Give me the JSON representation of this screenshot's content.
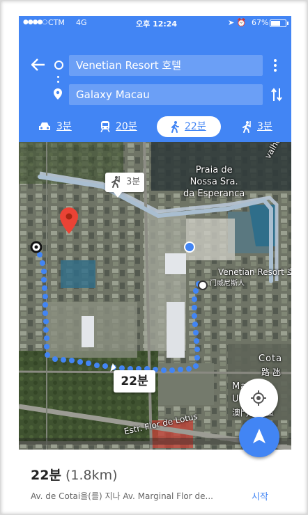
{
  "status": {
    "carrier": "CTM",
    "network": "4G",
    "time": "오후 12:24",
    "battery": "67%",
    "battery_level": 0.67
  },
  "route": {
    "origin": "Venetian Resort 호텔",
    "destination": "Galaxy Macau"
  },
  "modes": [
    {
      "name": "drive",
      "icon": "car-icon",
      "label": "3분",
      "selected": false
    },
    {
      "name": "transit",
      "icon": "train-icon",
      "label": "20분",
      "selected": false
    },
    {
      "name": "walk",
      "icon": "walk-icon",
      "label": "22분",
      "selected": true
    },
    {
      "name": "ride",
      "icon": "ride-icon",
      "label": "3분",
      "selected": false
    }
  ],
  "map": {
    "labels": {
      "valho": "valho",
      "praia_line1": "Praia de",
      "praia_line2": "Nossa Sra.",
      "praia_line3": "da Esperanca",
      "venetian": "Venetian Resort 호텔",
      "venetian_cn": "门威尼斯人",
      "cotai": "Cota",
      "cotai_cn": "路 氹",
      "macau": "Ma",
      "urbano": "Urbano",
      "macau_cn": "澳門新城區",
      "lotus": "Estr. Flor de Lotus"
    },
    "callout_alt": "3분",
    "callout_main": "22분"
  },
  "sheet": {
    "duration": "22분",
    "distance": "(1.8km)",
    "via": "Av. de Cotai을(를) 지나 Av. Marginal Flor de...",
    "start_label": "시작"
  },
  "colors": {
    "accent": "#4285f4",
    "route": "#4285f4",
    "pin": "#ea4335"
  }
}
